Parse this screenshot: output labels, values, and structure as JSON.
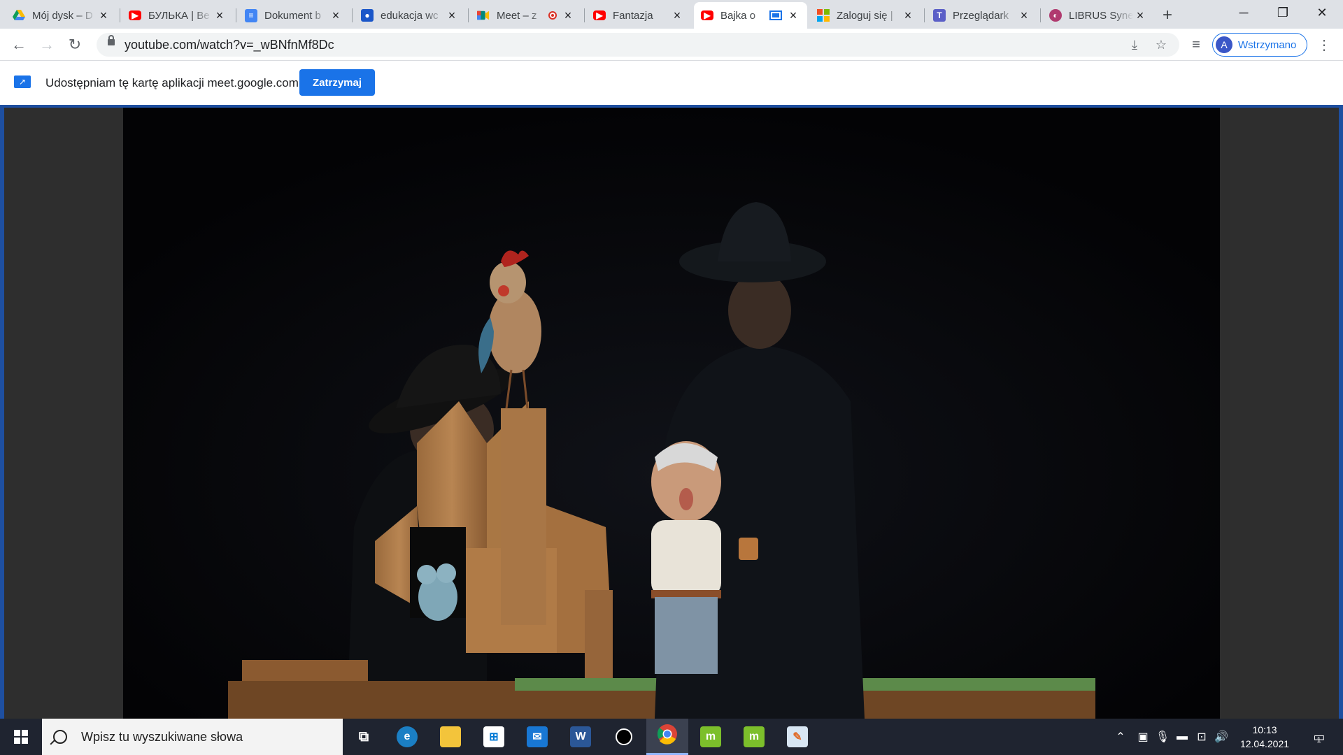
{
  "tabs": [
    {
      "title": "Mój dysk – D",
      "favicon": "drive-icon"
    },
    {
      "title": "БУЛЬКА | Ве",
      "favicon": "youtube-icon"
    },
    {
      "title": "Dokument b",
      "favicon": "docs-icon"
    },
    {
      "title": "edukacja wc",
      "favicon": "classroom-icon"
    },
    {
      "title": "Meet – z",
      "favicon": "meet-icon"
    },
    {
      "title": "Fantazja",
      "favicon": "youtube-icon"
    },
    {
      "title": "Bajka o",
      "favicon": "youtube-icon"
    },
    {
      "title": "Zaloguj się |",
      "favicon": "microsoft-icon"
    },
    {
      "title": "Przeglądark",
      "favicon": "teams-icon"
    },
    {
      "title": "LIBRUS Syne",
      "favicon": "librus-icon"
    }
  ],
  "address": {
    "url": "youtube.com/watch?v=_wBNfnMf8Dc"
  },
  "profile": {
    "initial": "A",
    "label": "Wstrzymano"
  },
  "sharebar": {
    "text": "Udostępniam tę kartę aplikacji meet.google.com",
    "stop_label": "Zatrzymaj"
  },
  "taskbar": {
    "search_placeholder": "Wpisz tu wyszukiwane słowa",
    "time": "10:13",
    "date": "12.04.2021",
    "notifications": "1"
  },
  "colors": {
    "accent": "#1a73e8",
    "frame": "#1e4fa0",
    "taskbar": "#1f2430"
  }
}
